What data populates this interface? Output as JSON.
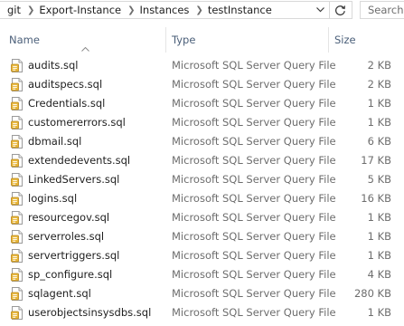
{
  "address_bar": {
    "breadcrumbs": [
      "git",
      "Export-Instance",
      "Instances",
      "testInstance"
    ],
    "search_placeholder": "Search"
  },
  "columns": {
    "name": "Name",
    "type": "Type",
    "size": "Size",
    "sorted_by": "Name",
    "sort_direction": "ascending"
  },
  "files": [
    {
      "name": "audits.sql",
      "type": "Microsoft SQL Server Query File",
      "size": "2 KB"
    },
    {
      "name": "auditspecs.sql",
      "type": "Microsoft SQL Server Query File",
      "size": "2 KB"
    },
    {
      "name": "Credentials.sql",
      "type": "Microsoft SQL Server Query File",
      "size": "1 KB"
    },
    {
      "name": "customererrors.sql",
      "type": "Microsoft SQL Server Query File",
      "size": "1 KB"
    },
    {
      "name": "dbmail.sql",
      "type": "Microsoft SQL Server Query File",
      "size": "6 KB"
    },
    {
      "name": "extendedevents.sql",
      "type": "Microsoft SQL Server Query File",
      "size": "17 KB"
    },
    {
      "name": "LinkedServers.sql",
      "type": "Microsoft SQL Server Query File",
      "size": "5 KB"
    },
    {
      "name": "logins.sql",
      "type": "Microsoft SQL Server Query File",
      "size": "16 KB"
    },
    {
      "name": "resourcegov.sql",
      "type": "Microsoft SQL Server Query File",
      "size": "1 KB"
    },
    {
      "name": "serverroles.sql",
      "type": "Microsoft SQL Server Query File",
      "size": "1 KB"
    },
    {
      "name": "servertriggers.sql",
      "type": "Microsoft SQL Server Query File",
      "size": "1 KB"
    },
    {
      "name": "sp_configure.sql",
      "type": "Microsoft SQL Server Query File",
      "size": "4 KB"
    },
    {
      "name": "sqlagent.sql",
      "type": "Microsoft SQL Server Query File",
      "size": "280 KB"
    },
    {
      "name": "userobjectsinsysdbs.sql",
      "type": "Microsoft SQL Server Query File",
      "size": "1 KB"
    }
  ],
  "icons": {
    "file_icon": "sql-file-icon",
    "breadcrumb_separator": "chevron-right-icon",
    "dropdown": "chevron-down-icon",
    "refresh": "refresh-icon",
    "sort": "sort-ascending-icon"
  },
  "colors": {
    "header_text": "#4c607a",
    "secondary_text": "#6d6d6d",
    "file_icon_accent": "#e8b536"
  }
}
